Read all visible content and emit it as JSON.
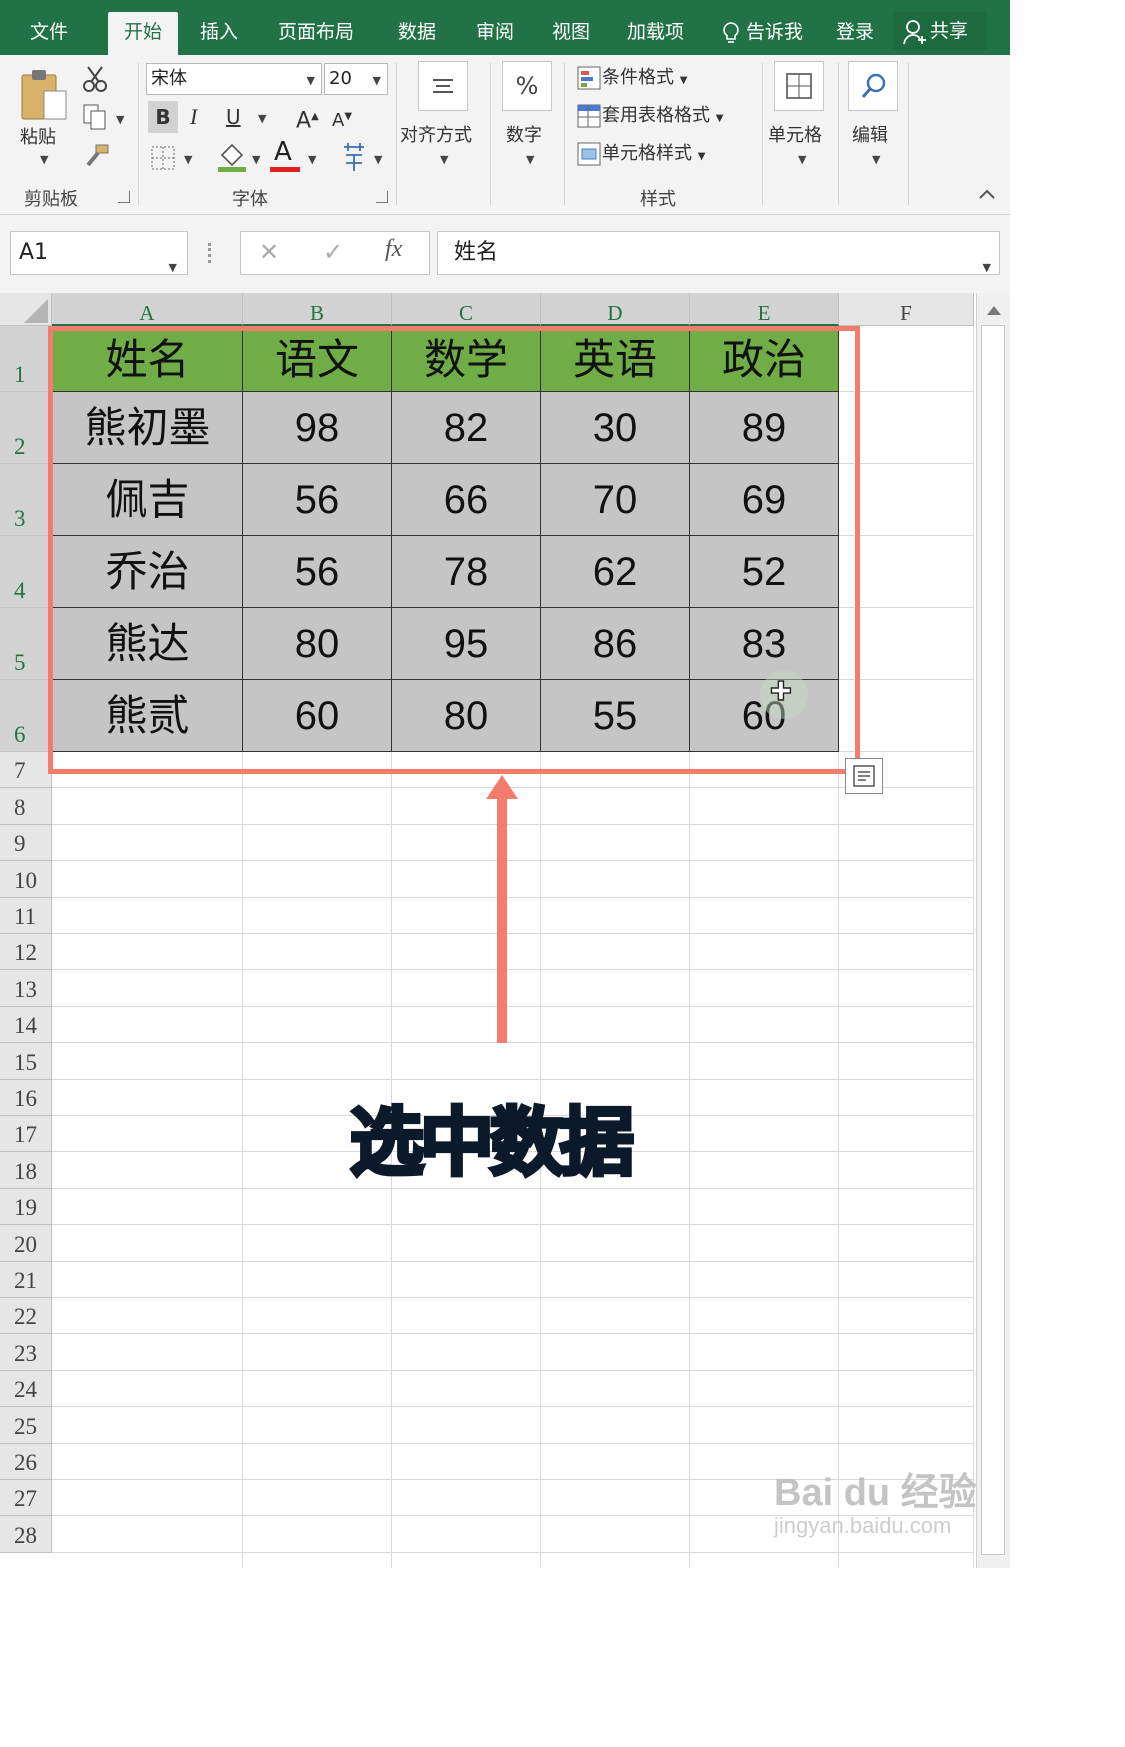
{
  "tabs": [
    "文件",
    "开始",
    "插入",
    "页面布局",
    "数据",
    "审阅",
    "视图",
    "加载项"
  ],
  "active_tab": "开始",
  "tell_me": "告诉我",
  "login": "登录",
  "share": "共享",
  "ribbon": {
    "clipboard": {
      "paste": "粘贴",
      "group": "剪贴板"
    },
    "font": {
      "name": "宋体",
      "size": "20",
      "bold": "B",
      "italic": "I",
      "underline": "U",
      "grow": "A",
      "shrink": "A",
      "color": "A",
      "group": "字体"
    },
    "alignment": {
      "label": "对齐方式"
    },
    "number": {
      "label": "数字",
      "symbol": "%"
    },
    "styles": {
      "conditional": "条件格式",
      "table_format": "套用表格格式",
      "cell_styles": "单元格样式",
      "group": "样式"
    },
    "cells": {
      "label": "单元格"
    },
    "editing": {
      "label": "编辑"
    }
  },
  "formula_bar": {
    "name_box": "A1",
    "fx": "fx",
    "value": "姓名"
  },
  "columns": [
    "A",
    "B",
    "C",
    "D",
    "E",
    "F"
  ],
  "row_numbers": [
    "1",
    "2",
    "3",
    "4",
    "5",
    "6",
    "7",
    "8",
    "9",
    "10",
    "11",
    "12",
    "13",
    "14",
    "15",
    "16",
    "17",
    "18",
    "19",
    "20",
    "21",
    "22",
    "23",
    "24",
    "25",
    "26",
    "27",
    "28"
  ],
  "table": {
    "headers": [
      "姓名",
      "语文",
      "数学",
      "英语",
      "政治"
    ],
    "rows": [
      [
        "熊初墨",
        "98",
        "82",
        "30",
        "89"
      ],
      [
        "佩吉",
        "56",
        "66",
        "70",
        "69"
      ],
      [
        "乔治",
        "56",
        "78",
        "62",
        "52"
      ],
      [
        "熊达",
        "80",
        "95",
        "86",
        "83"
      ],
      [
        "熊贰",
        "60",
        "80",
        "55",
        "60"
      ]
    ]
  },
  "annotation": {
    "caption": "选中数据",
    "color": "#f47c6c"
  },
  "watermark": {
    "brand": "Bai du 经验",
    "url": "jingyan.baidu.com"
  },
  "colors": {
    "excel_green": "#217346",
    "header_fill": "#70ad47",
    "cell_fill": "#c5c5c5"
  }
}
